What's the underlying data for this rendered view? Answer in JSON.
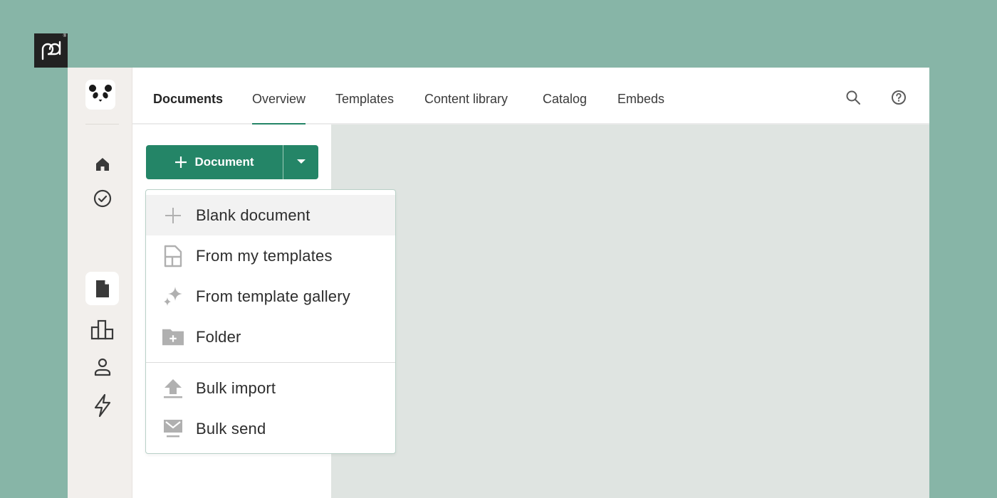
{
  "brand": {
    "logo_text": "pd",
    "registered_mark": "®"
  },
  "sidebar": {
    "logo_icon": "panda-icon",
    "items": [
      {
        "icon": "home-icon",
        "label": "Home",
        "active": false
      },
      {
        "icon": "check-circle-icon",
        "label": "Tasks",
        "active": false
      },
      {
        "icon": "document-icon",
        "label": "Documents",
        "active": true
      },
      {
        "icon": "bar-chart-icon",
        "label": "Reports",
        "active": false
      },
      {
        "icon": "user-icon",
        "label": "Contacts",
        "active": false
      },
      {
        "icon": "lightning-icon",
        "label": "Automations",
        "active": false
      }
    ]
  },
  "topbar": {
    "title": "Documents",
    "tabs": [
      {
        "label": "Overview",
        "active": true
      },
      {
        "label": "Templates",
        "active": false
      },
      {
        "label": "Content library",
        "active": false
      },
      {
        "label": "Catalog",
        "active": false
      },
      {
        "label": "Embeds",
        "active": false
      }
    ],
    "icons": [
      "search-icon",
      "help-icon"
    ]
  },
  "new_button": {
    "label": "Document",
    "icon": "plus-icon",
    "dropdown_icon": "caret-down-icon",
    "color": "#248567"
  },
  "menu": {
    "items": [
      {
        "label": "Blank document",
        "icon": "plus-icon",
        "highlighted": true
      },
      {
        "label": "From my templates",
        "icon": "template-icon",
        "highlighted": false
      },
      {
        "label": "From template gallery",
        "icon": "sparkle-icon",
        "highlighted": false
      },
      {
        "label": "Folder",
        "icon": "folder-plus-icon",
        "highlighted": false
      },
      {
        "label": "Bulk import",
        "icon": "upload-icon",
        "highlighted": false
      },
      {
        "label": "Bulk send",
        "icon": "bulk-send-icon",
        "highlighted": false
      }
    ]
  },
  "colors": {
    "background": "#87b5a7",
    "accent": "#248567",
    "sidebar": "#f2efec",
    "content": "#dfe4e1"
  }
}
